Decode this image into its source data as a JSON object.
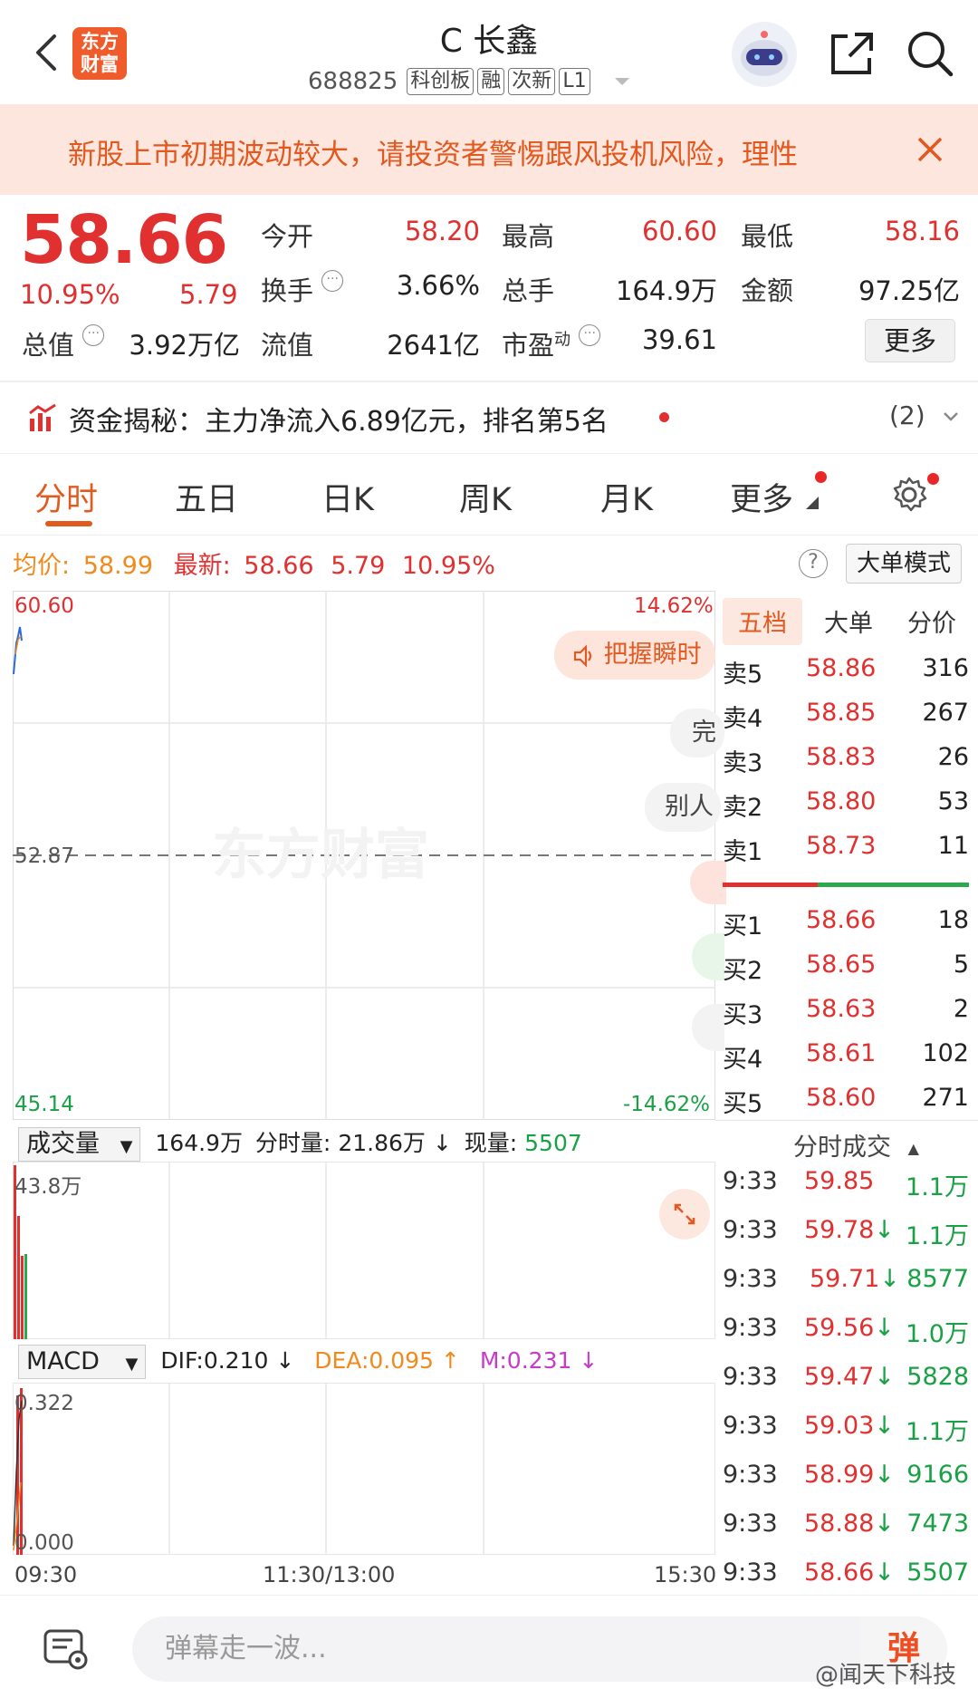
{
  "header": {
    "logo_line1": "东方",
    "logo_line2": "财富",
    "title": "C 长鑫",
    "code": "688825",
    "tags": [
      "科创板",
      "融",
      "次新",
      "L1"
    ]
  },
  "warning": {
    "text": "新股上市初期波动较大，请投资者警惕跟风投机风险，理性"
  },
  "quote": {
    "price": "58.66",
    "change_pct": "10.95%",
    "change": "5.79",
    "fields": {
      "open_label": "今开",
      "open": "58.20",
      "high_label": "最高",
      "high": "60.60",
      "low_label": "最低",
      "low": "58.16",
      "turnover_label": "换手",
      "turnover": "3.66%",
      "volume_label": "总手",
      "volume": "164.9万",
      "amount_label": "金额",
      "amount": "97.25亿",
      "mktcap_label": "总值",
      "mktcap": "3.92万亿",
      "float_label": "流值",
      "float": "2641亿",
      "pe_label": "市盈",
      "pe_sup": "动",
      "pe": "39.61"
    },
    "more_label": "更多"
  },
  "capital": {
    "text": "资金揭秘：主力净流入6.89亿元，排名第5名",
    "count": "(2)"
  },
  "tabs": [
    "分时",
    "五日",
    "日K",
    "周K",
    "月K",
    "更多"
  ],
  "avg_row": {
    "avg_label": "均价:",
    "avg": "58.99",
    "latest_label": "最新:",
    "latest": "58.66",
    "change": "5.79",
    "pct": "10.95%",
    "bigorder_label": "大单模式"
  },
  "chart": {
    "y_max": "60.60",
    "y_mid": "52.87",
    "y_min": "45.14",
    "pct_max": "14.62%",
    "pct_min": "-14.62%",
    "watermark": "东方财富",
    "pill_1": "把握瞬时",
    "pill_2": "完",
    "pill_3": "别人"
  },
  "book": {
    "tabs": [
      "五档",
      "大单",
      "分价"
    ],
    "sell": [
      {
        "label": "卖5",
        "price": "58.86",
        "vol": "316"
      },
      {
        "label": "卖4",
        "price": "58.85",
        "vol": "267"
      },
      {
        "label": "卖3",
        "price": "58.83",
        "vol": "26"
      },
      {
        "label": "卖2",
        "price": "58.80",
        "vol": "53"
      },
      {
        "label": "卖1",
        "price": "58.73",
        "vol": "11"
      }
    ],
    "buy": [
      {
        "label": "买1",
        "price": "58.66",
        "vol": "18"
      },
      {
        "label": "买2",
        "price": "58.65",
        "vol": "5"
      },
      {
        "label": "买3",
        "price": "58.63",
        "vol": "2"
      },
      {
        "label": "买4",
        "price": "58.61",
        "vol": "102"
      },
      {
        "label": "买5",
        "price": "58.60",
        "vol": "271"
      }
    ]
  },
  "volume": {
    "select": "成交量",
    "total": "164.9万",
    "minute_label": "分时量:",
    "minute": "21.86万",
    "current_label": "现量:",
    "current": "5507",
    "y_max": "43.8万"
  },
  "macd": {
    "select": "MACD",
    "dif": "DIF:0.210",
    "dea": "DEA:0.095",
    "m": "M:0.231",
    "y_max": "0.322",
    "y_min": "0.000"
  },
  "trades": {
    "title": "分时成交",
    "rows": [
      {
        "time": "9:33",
        "price": "59.85",
        "arrow": "",
        "vol": "1.1万",
        "vol_color": "#1aa045"
      },
      {
        "time": "9:33",
        "price": "59.78",
        "arrow": "↓",
        "vol": "1.1万",
        "vol_color": "#1aa045"
      },
      {
        "time": "9:33",
        "price": "59.71",
        "arrow": "↓",
        "vol": "8577",
        "vol_color": "#1aa045"
      },
      {
        "time": "9:33",
        "price": "59.56",
        "arrow": "↓",
        "vol": "1.0万",
        "vol_color": "#1aa045"
      },
      {
        "time": "9:33",
        "price": "59.47",
        "arrow": "↓",
        "vol": "5828",
        "vol_color": "#1aa045"
      },
      {
        "time": "9:33",
        "price": "59.03",
        "arrow": "↓",
        "vol": "1.1万",
        "vol_color": "#1aa045"
      },
      {
        "time": "9:33",
        "price": "58.99",
        "arrow": "↓",
        "vol": "9166",
        "vol_color": "#1aa045"
      },
      {
        "time": "9:33",
        "price": "58.88",
        "arrow": "↓",
        "vol": "7473",
        "vol_color": "#1aa045"
      },
      {
        "time": "9:33",
        "price": "58.66",
        "arrow": "↓",
        "vol": "5507",
        "vol_color": "#1aa045"
      }
    ]
  },
  "time_axis": [
    "09:30",
    "11:30/13:00",
    "15:30"
  ],
  "bottom": {
    "placeholder": "弹幕走一波...",
    "send_label": "弹",
    "watermark": "@闻天下科技"
  },
  "colors": {
    "up": "#e03030",
    "down": "#1aa045",
    "accent": "#e15b1f",
    "warning_bg": "#fde6de"
  }
}
